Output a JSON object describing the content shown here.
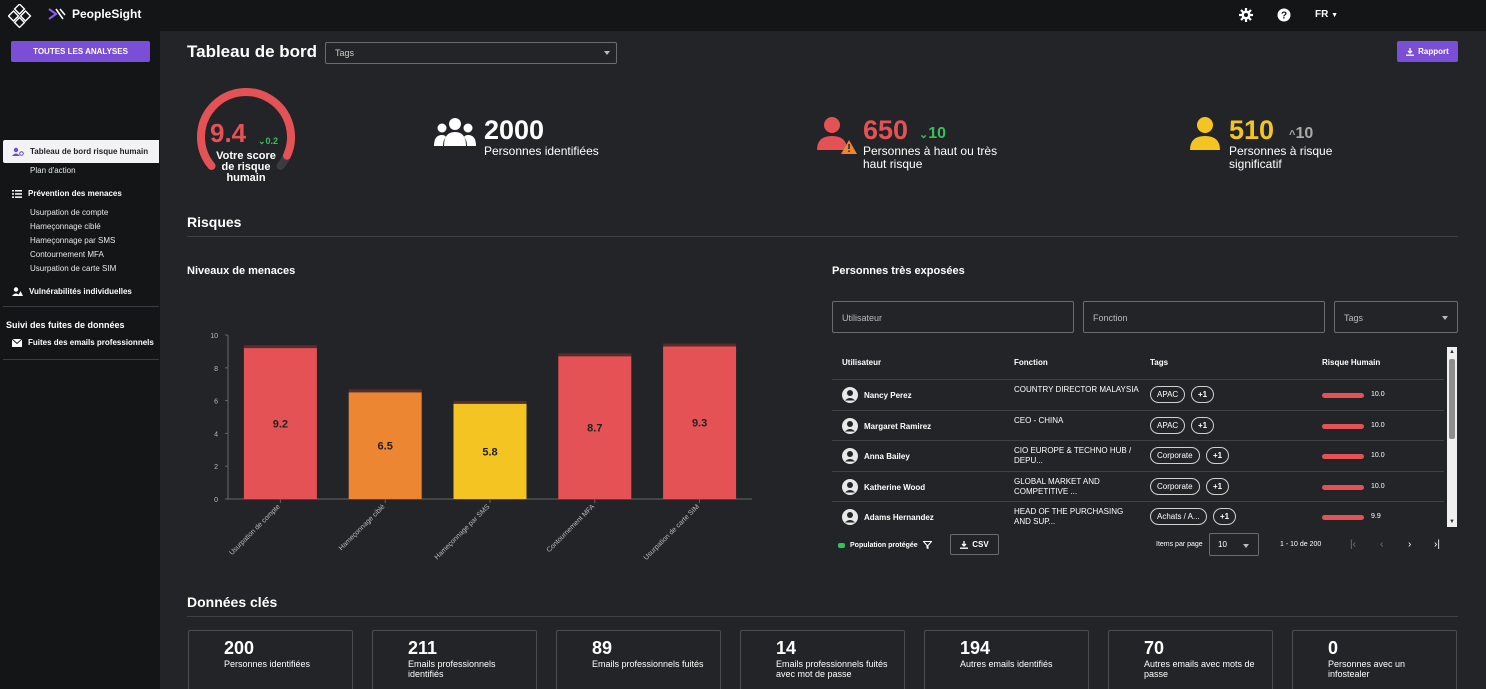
{
  "app": {
    "brand": "PeopleSight",
    "language": "FR"
  },
  "sidebar": {
    "all_analyses": "TOUTES LES ANALYSES",
    "active_item": "Tableau de bord risque humain",
    "action_plan": "Plan d'action",
    "threat_prevention": "Prévention des menaces",
    "threat_items": [
      "Usurpation de compte",
      "Hameçonnage ciblé",
      "Hameçonnage par SMS",
      "Contournement MFA",
      "Usurpation de carte SIM"
    ],
    "individual_vulns": "Vulnérabilités individuelles",
    "leaks_section": "Suivi des fuites de données",
    "pro_email_leaks": "Fuites des emails professionnels"
  },
  "header": {
    "title": "Tableau de bord",
    "tags_placeholder": "Tags",
    "report": "Rapport"
  },
  "score": {
    "value": "9.4",
    "delta": "0.2",
    "label": "Votre score de risque humain",
    "fraction": 0.94
  },
  "stats": [
    {
      "value": "2000",
      "label": "Personnes identifiées"
    },
    {
      "value": "650",
      "delta": "10",
      "label": "Personnes à haut ou très haut risque"
    },
    {
      "value": "510",
      "delta": "10",
      "label": "Personnes à risque significatif"
    }
  ],
  "risks": {
    "title": "Risques",
    "threat_levels_title": "Niveaux de menaces",
    "exposed_title": "Personnes très exposées"
  },
  "chart_data": {
    "type": "bar",
    "categories": [
      "Usurpation de compte",
      "Hameçonnage ciblé",
      "Hameçonnage par SMS",
      "Contournement MFA",
      "Usurpation de carte SIM"
    ],
    "values": [
      9.2,
      6.5,
      5.8,
      8.7,
      9.3
    ],
    "colors": [
      "#e45255",
      "#ec8632",
      "#f4c522",
      "#e45255",
      "#e45255"
    ],
    "y_ticks": [
      "0",
      "2",
      "4",
      "6",
      "8",
      "10"
    ],
    "ylim": [
      0,
      10
    ],
    "grid": false,
    "legend": "none"
  },
  "filters": {
    "user": "Utilisateur",
    "function": "Fonction",
    "tags": "Tags"
  },
  "table": {
    "headers": {
      "user": "Utilisateur",
      "function": "Fonction",
      "tags": "Tags",
      "risk": "Risque Humain"
    },
    "rows": [
      {
        "name": "Nancy Perez",
        "function": "COUNTRY DIRECTOR MALAYSIA",
        "tag": "APAC",
        "more": "+1",
        "risk": "10.0",
        "risk_fraction": 1.0
      },
      {
        "name": "Margaret Ramirez",
        "function": "CEO - CHINA",
        "tag": "APAC",
        "more": "+1",
        "risk": "10.0",
        "risk_fraction": 1.0
      },
      {
        "name": "Anna Bailey",
        "function": "CIO EUROPE & TECHNO HUB / DEPU...",
        "tag": "Corporate",
        "more": "+1",
        "risk": "10.0",
        "risk_fraction": 1.0
      },
      {
        "name": "Katherine Wood",
        "function": "GLOBAL MARKET AND COMPETITIVE ...",
        "tag": "Corporate",
        "more": "+1",
        "risk": "10.0",
        "risk_fraction": 1.0
      },
      {
        "name": "Adams Hernandez",
        "function": "HEAD OF THE PURCHASING AND SUP...",
        "tag": "Achats / A...",
        "more": "+1",
        "risk": "9.9",
        "risk_fraction": 0.99
      }
    ],
    "protected": "Population protégée",
    "csv": "CSV",
    "items_per_page_label": "Items par page",
    "items_per_page": "10",
    "range": "1 - 10 de 200"
  },
  "key_data": {
    "title": "Données clés",
    "cards": [
      {
        "value": "200",
        "label": "Personnes identifiées"
      },
      {
        "value": "211",
        "label": "Emails professionnels identifiés"
      },
      {
        "value": "89",
        "label": "Emails professionnels fuités"
      },
      {
        "value": "14",
        "label": "Emails professionnels fuités avec mot de passe"
      },
      {
        "value": "194",
        "label": "Autres emails identifiés"
      },
      {
        "value": "70",
        "label": "Autres emails avec mots de passe"
      },
      {
        "value": "0",
        "label": "Personnes avec un infostealer"
      }
    ]
  }
}
